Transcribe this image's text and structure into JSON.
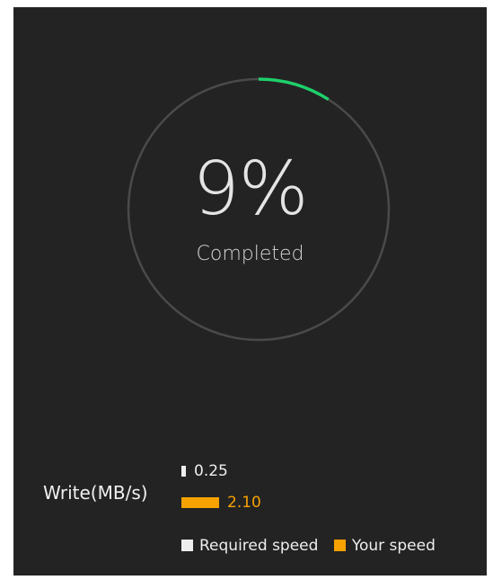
{
  "progress": {
    "percent_text": "9%",
    "fraction": 0.09,
    "status_label": "Completed"
  },
  "speed": {
    "metric_label": "Write(MB/s)",
    "required": {
      "value": 0.25,
      "text": "0.25"
    },
    "yours": {
      "value": 2.1,
      "text": "2.10"
    },
    "scale_max": 2.4
  },
  "legend": {
    "required_label": "Required speed",
    "your_label": "Your speed"
  },
  "colors": {
    "background": "#232323",
    "ring_track": "#4a4a4a",
    "ring_progress": "#1fcf6b",
    "required": "#eeeeee",
    "yours": "#f7a200"
  }
}
